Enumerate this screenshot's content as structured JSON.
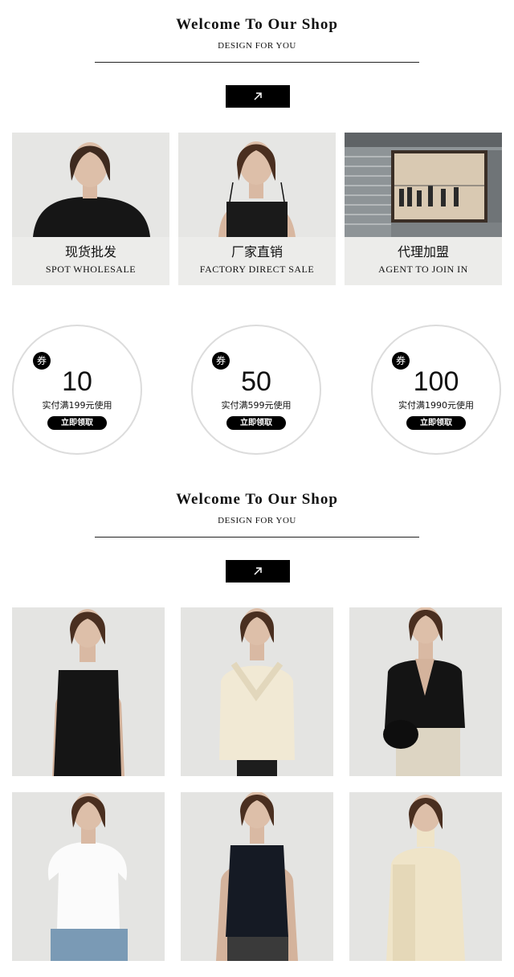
{
  "header_top": {
    "title": "Welcome To Our Shop",
    "subtitle": "DESIGN FOR YOU"
  },
  "categories": [
    {
      "label_zh": "现货批发",
      "label_en": "SPOT WHOLESALE"
    },
    {
      "label_zh": "厂家直销",
      "label_en": "FACTORY DIRECT SALE"
    },
    {
      "label_zh": "代理加盟",
      "label_en": "AGENT TO JOIN IN"
    }
  ],
  "coupons": [
    {
      "badge": "券",
      "amount": "10",
      "condition": "实付满199元使用",
      "button": "立即领取"
    },
    {
      "badge": "券",
      "amount": "50",
      "condition": "实付满599元使用",
      "button": "立即领取"
    },
    {
      "badge": "券",
      "amount": "100",
      "condition": "实付满1990元使用",
      "button": "立即领取"
    }
  ],
  "header_bottom": {
    "title": "Welcome To Our Shop",
    "subtitle": "DESIGN FOR YOU"
  },
  "icons": {
    "arrow": "arrow-up-right-icon"
  },
  "colors": {
    "accent": "#000000",
    "card_bg": "#ececea",
    "coupon_border": "#dcdcdc"
  }
}
